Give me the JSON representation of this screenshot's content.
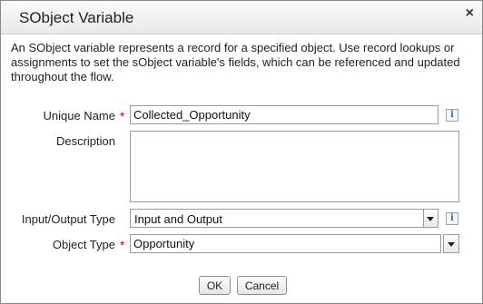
{
  "dialog": {
    "title": "SObject Variable",
    "close_symbol": "×",
    "description": "An SObject variable represents a record for a specified object. Use record lookups or assignments to set the sObject variable's fields, which can be referenced and updated throughout the flow."
  },
  "form": {
    "unique_name": {
      "label": "Unique Name",
      "required_marker": "*",
      "value": "Collected_Opportunity",
      "info_symbol": "i"
    },
    "description": {
      "label": "Description",
      "value": ""
    },
    "io_type": {
      "label": "Input/Output Type",
      "selected": "Input and Output",
      "info_symbol": "i"
    },
    "object_type": {
      "label": "Object Type",
      "required_marker": "*",
      "value": "Opportunity"
    }
  },
  "buttons": {
    "ok": "OK",
    "cancel": "Cancel"
  },
  "colors": {
    "required": "#cc0000",
    "info_icon": "#3b6ea5"
  }
}
